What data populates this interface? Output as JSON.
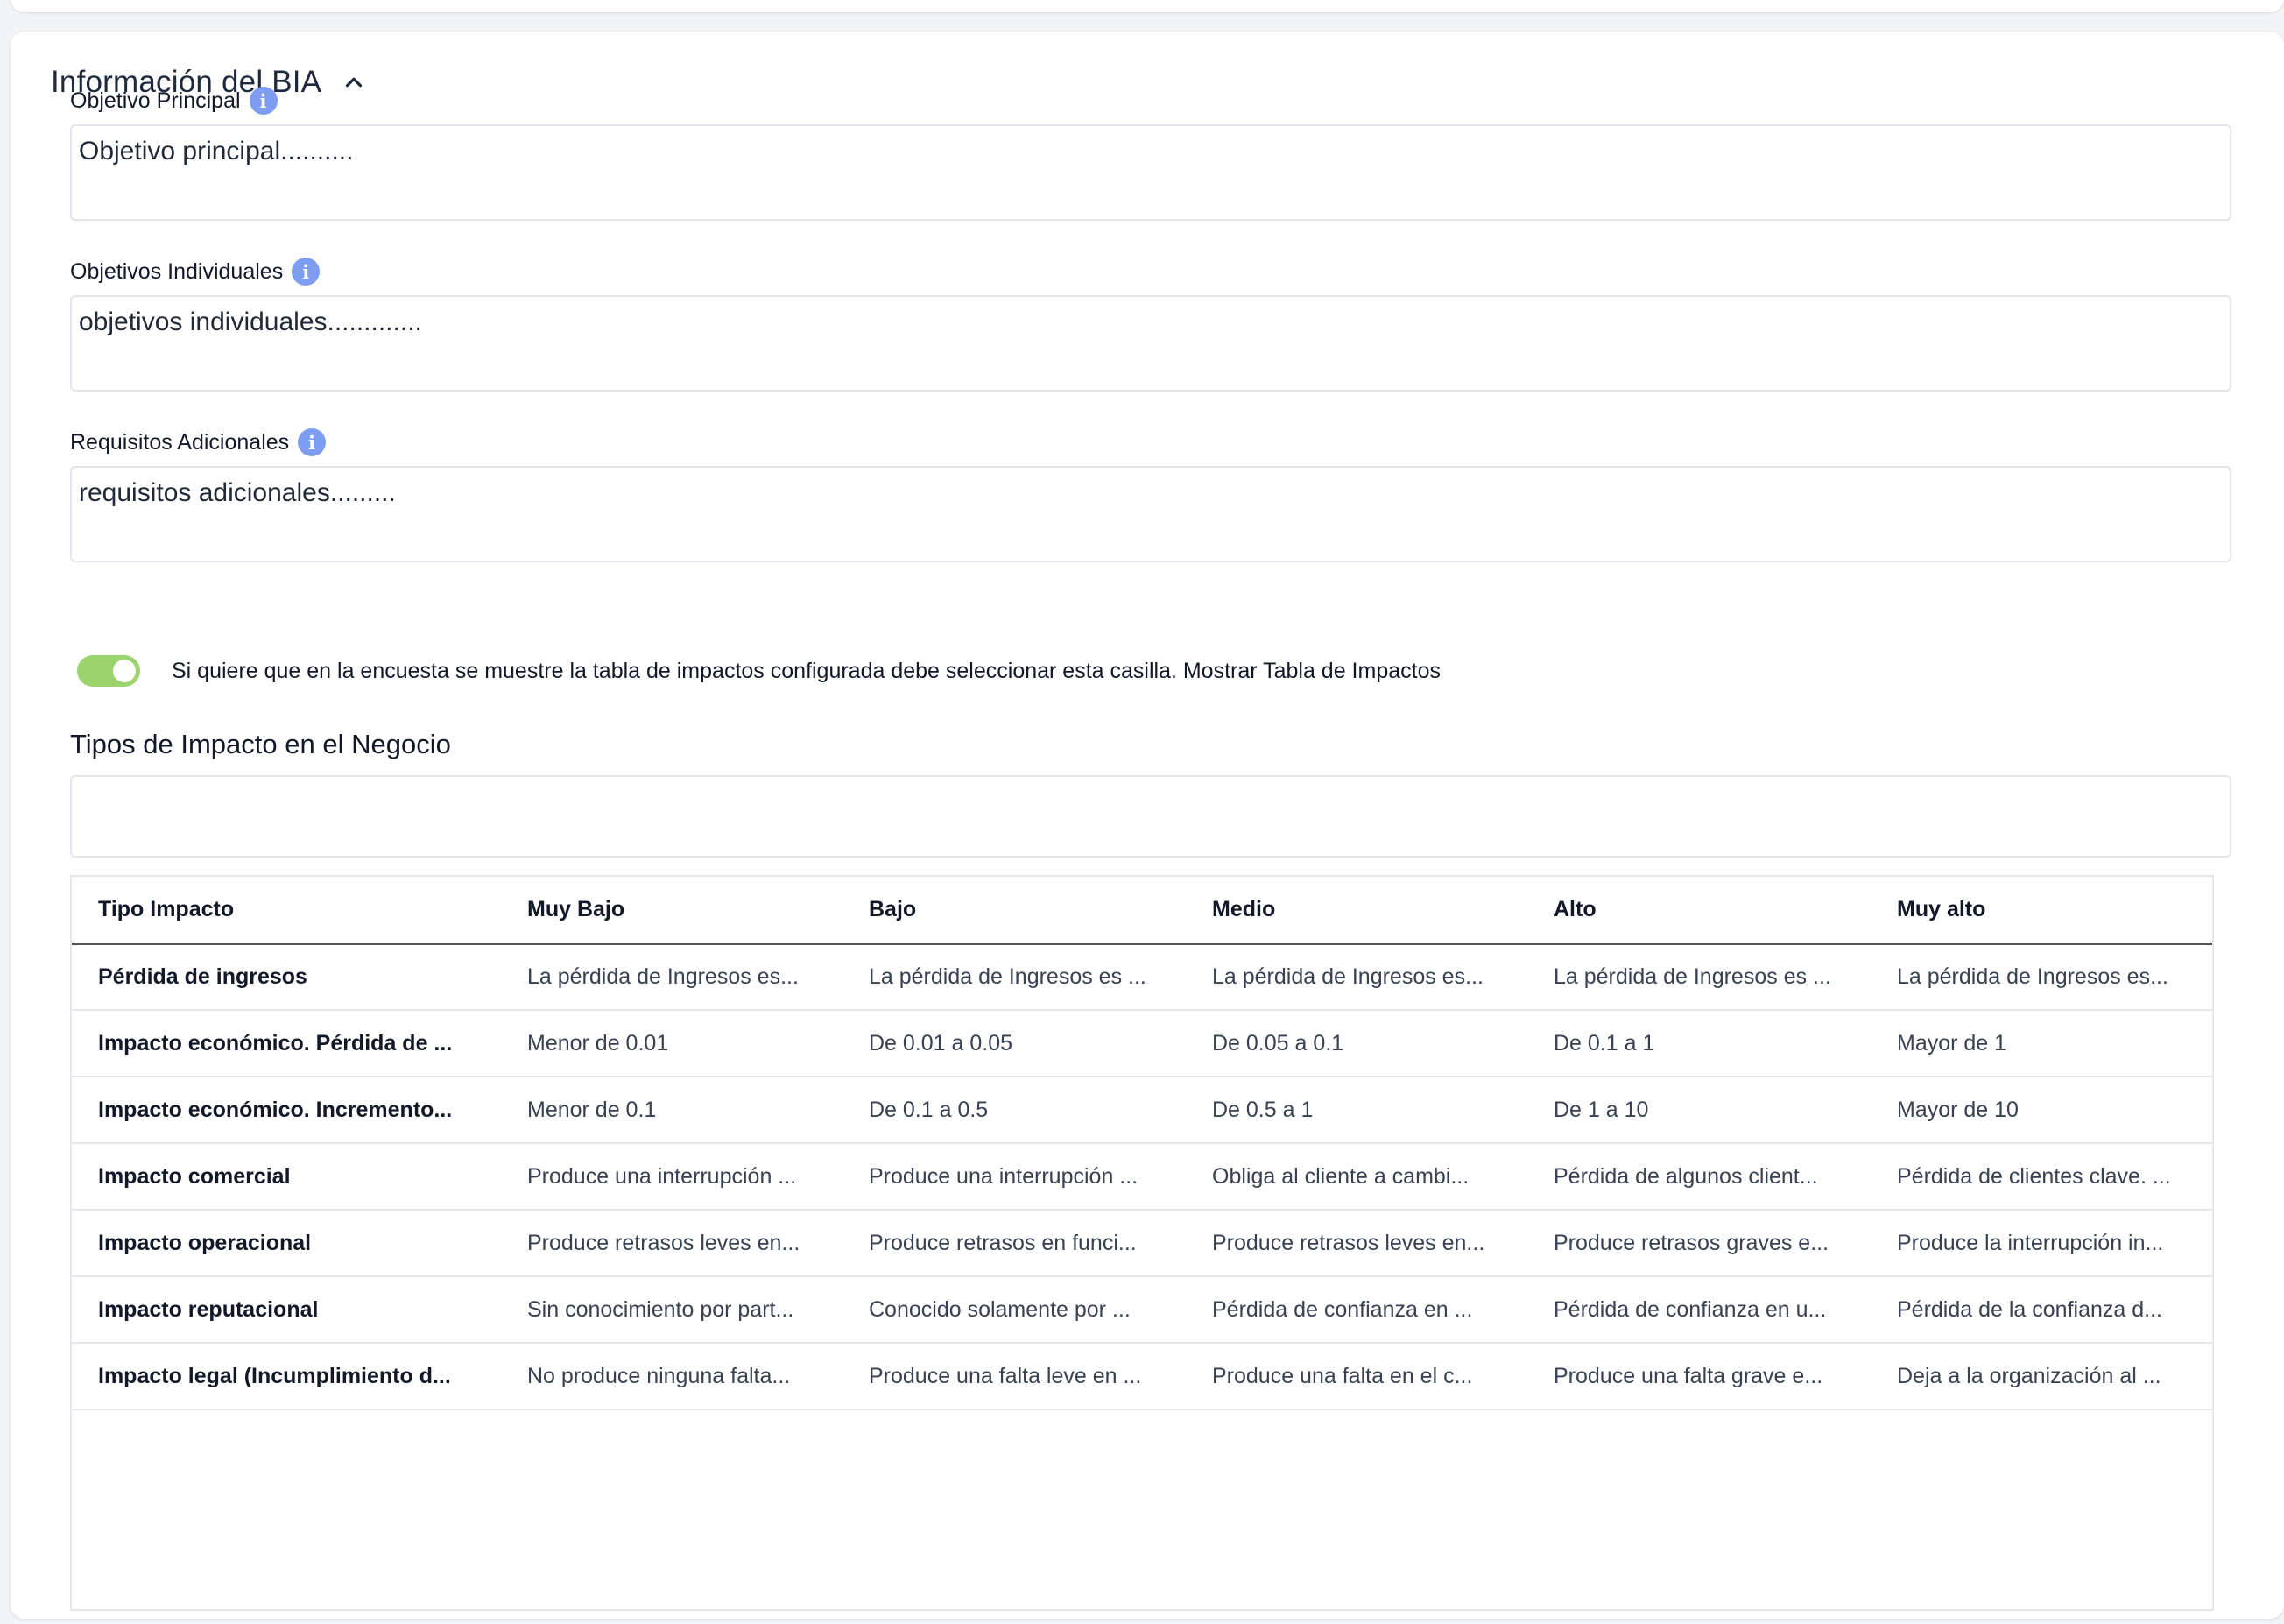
{
  "section": {
    "title": "Información del BIA"
  },
  "fields": {
    "objetivo_principal": {
      "label": "Objetivo Principal",
      "value": "Objetivo principal.........."
    },
    "objetivos_individuales": {
      "label": "Objetivos Individuales",
      "value": "objetivos individuales............."
    },
    "requisitos_adicionales": {
      "label": "Requisitos Adicionales",
      "value": "requisitos adicionales........."
    }
  },
  "toggle": {
    "state": "on",
    "text": "Si quiere que en la encuesta se muestre la tabla de impactos configurada debe seleccionar esta casilla.  Mostrar Tabla de Impactos",
    "color": "#9bd36c"
  },
  "impact_section": {
    "title": "Tipos de Impacto en el Negocio",
    "input_value": ""
  },
  "table": {
    "headers": [
      "Tipo Impacto",
      "Muy Bajo",
      "Bajo",
      "Medio",
      "Alto",
      "Muy alto"
    ],
    "rows": [
      [
        "Pérdida de ingresos",
        "La pérdida de Ingresos es...",
        "La pérdida de Ingresos es ...",
        "La pérdida de Ingresos es...",
        "La pérdida de Ingresos es ...",
        "La pérdida de Ingresos es..."
      ],
      [
        "Impacto económico. Pérdida de ...",
        "Menor de 0.01",
        "De 0.01 a 0.05",
        "De 0.05 a 0.1",
        "De 0.1 a 1",
        "Mayor de 1"
      ],
      [
        "Impacto económico. Incremento...",
        "Menor de 0.1",
        "De 0.1 a 0.5",
        "De 0.5 a 1",
        "De 1 a 10",
        "Mayor de 10"
      ],
      [
        "Impacto comercial",
        "Produce una interrupción ...",
        "Produce una interrupción ...",
        "Obliga al cliente a cambi...",
        "Pérdida de algunos client...",
        "Pérdida de clientes clave. ..."
      ],
      [
        "Impacto operacional",
        "Produce retrasos leves en...",
        "Produce retrasos en funci...",
        "Produce retrasos leves en...",
        "Produce retrasos graves e...",
        "Produce la interrupción in..."
      ],
      [
        "Impacto reputacional",
        "Sin conocimiento por part...",
        "Conocido solamente por ...",
        "Pérdida de confianza en ...",
        "Pérdida de confianza en u...",
        "Pérdida de la confianza d..."
      ],
      [
        "Impacto legal (Incumplimiento d...",
        "No produce ninguna falta...",
        "Produce una falta leve en ...",
        "Produce una falta en el c...",
        "Produce una falta grave e...",
        "Deja a la organización al ..."
      ]
    ]
  },
  "colors": {
    "info_icon": "#7d9cf2",
    "accent_toggle": "#9bd36c"
  },
  "icons": {
    "section_toggle": "chevron-up-icon",
    "field_help": "info-icon"
  }
}
